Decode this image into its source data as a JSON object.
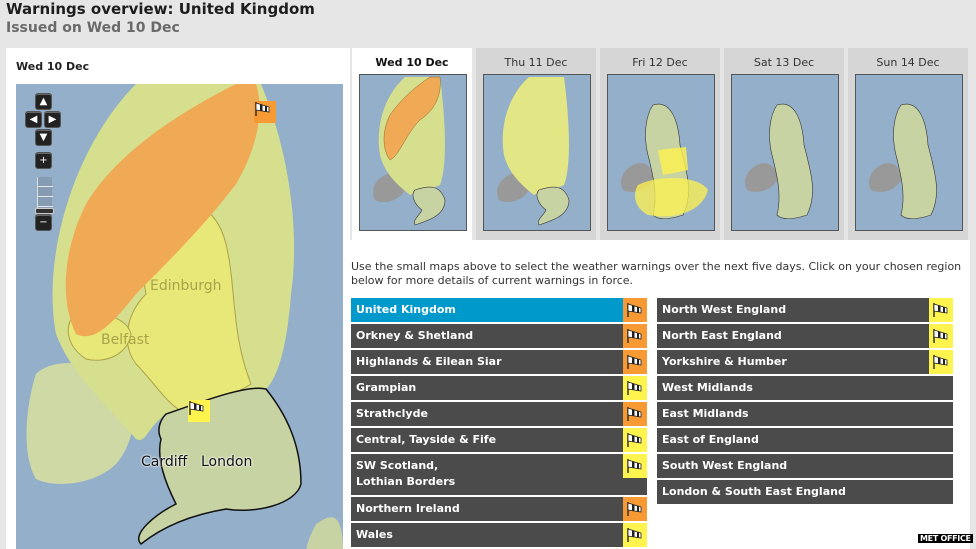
{
  "header": {
    "title": "Warnings overview: United Kingdom",
    "subtitle": "Issued on Wed 10 Dec"
  },
  "main_map": {
    "date_label": "Wed 10 Dec",
    "controls": {
      "pan_up": "▲",
      "pan_left": "◀",
      "pan_right": "▶",
      "pan_down": "▼",
      "zoom_in": "+",
      "zoom_out": "−"
    },
    "labels": {
      "edinburgh": "Edinburgh",
      "belfast": "Belfast",
      "cardiff": "Cardiff",
      "london": "London"
    },
    "warnings": [
      {
        "level": "amber",
        "icon": "wind-icon"
      },
      {
        "level": "yellow",
        "icon": "wind-icon"
      }
    ]
  },
  "day_tabs": [
    {
      "label": "Wed 10 Dec",
      "active": true
    },
    {
      "label": "Thu 11 Dec",
      "active": false
    },
    {
      "label": "Fri 12 Dec",
      "active": false
    },
    {
      "label": "Sat 13 Dec",
      "active": false
    },
    {
      "label": "Sun 14 Dec",
      "active": false
    }
  ],
  "intro_text": "Use the small maps above to select the weather warnings over the next five days. Click on your chosen region below for more details of current warnings in force.",
  "regions_left": [
    {
      "label": "United Kingdom",
      "warning": "amber",
      "active": true
    },
    {
      "label": "Orkney & Shetland",
      "warning": "amber"
    },
    {
      "label": "Highlands & Eilean Siar",
      "warning": "amber"
    },
    {
      "label": "Grampian",
      "warning": "yellow"
    },
    {
      "label": "Strathclyde",
      "warning": "amber"
    },
    {
      "label": "Central, Tayside & Fife",
      "warning": "yellow"
    },
    {
      "label": "SW Scotland, Lothian Borders",
      "warning": "yellow"
    },
    {
      "label": "Northern Ireland",
      "warning": "amber"
    },
    {
      "label": "Wales",
      "warning": "yellow"
    }
  ],
  "regions_right": [
    {
      "label": "North West England",
      "warning": "yellow"
    },
    {
      "label": "North East England",
      "warning": "yellow"
    },
    {
      "label": "Yorkshire & Humber",
      "warning": "yellow"
    },
    {
      "label": "West Midlands",
      "warning": "none"
    },
    {
      "label": "East Midlands",
      "warning": "none"
    },
    {
      "label": "East of England",
      "warning": "none"
    },
    {
      "label": "South West England",
      "warning": "none"
    },
    {
      "label": "London & South East England",
      "warning": "none"
    }
  ],
  "colors": {
    "amber": "#f79a33",
    "yellow": "#fff34d",
    "active_region": "#0099cc",
    "region_bg": "#4b4b4b",
    "sea": "#94afc9",
    "land": "#cfd9a6"
  },
  "watermark": "MET OFFICE"
}
